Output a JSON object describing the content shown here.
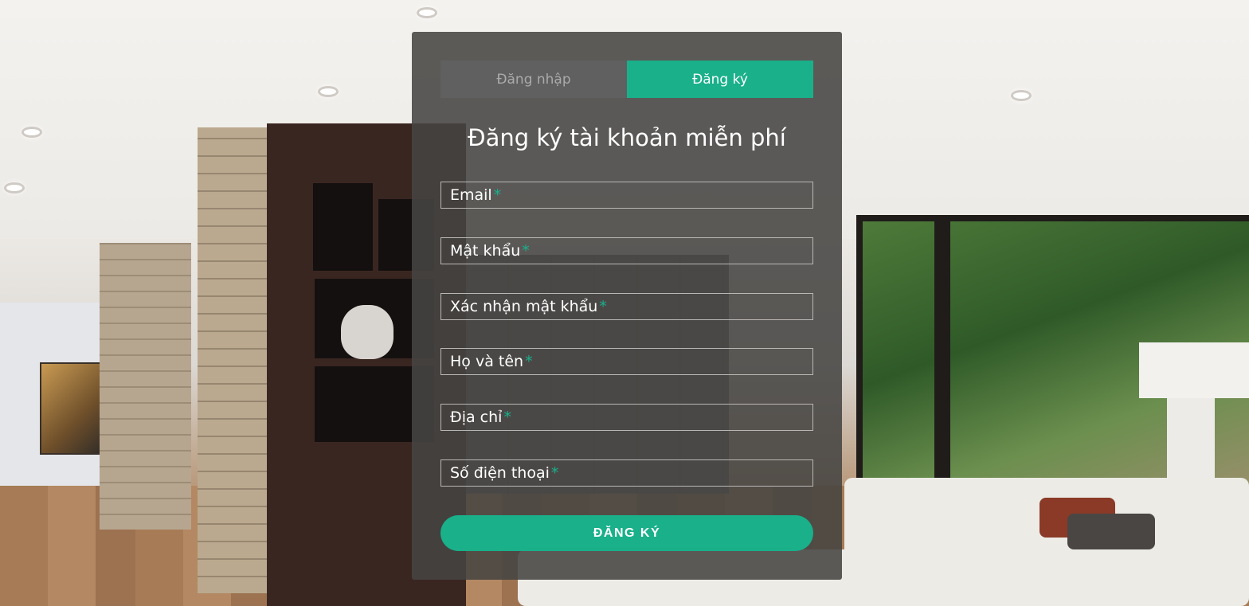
{
  "tabs": [
    {
      "label": "Đăng nhập",
      "active": false
    },
    {
      "label": "Đăng ký",
      "active": true
    }
  ],
  "form": {
    "title": "Đăng ký tài khoản miễn phí",
    "required_marker": "*",
    "fields": [
      {
        "label": "Email",
        "value": ""
      },
      {
        "label": "Mật khẩu",
        "value": ""
      },
      {
        "label": "Xác nhận mật khẩu",
        "value": ""
      },
      {
        "label": "Họ và tên",
        "value": ""
      },
      {
        "label": "Địa chỉ",
        "value": ""
      },
      {
        "label": "Số điện thoại",
        "value": ""
      }
    ],
    "submit_label": "ĐĂNG KÝ"
  },
  "colors": {
    "accent": "#19b08a",
    "panel": "#464442",
    "inactive_tab": "#5f605f",
    "inactive_tab_text": "#a9aaa9"
  }
}
